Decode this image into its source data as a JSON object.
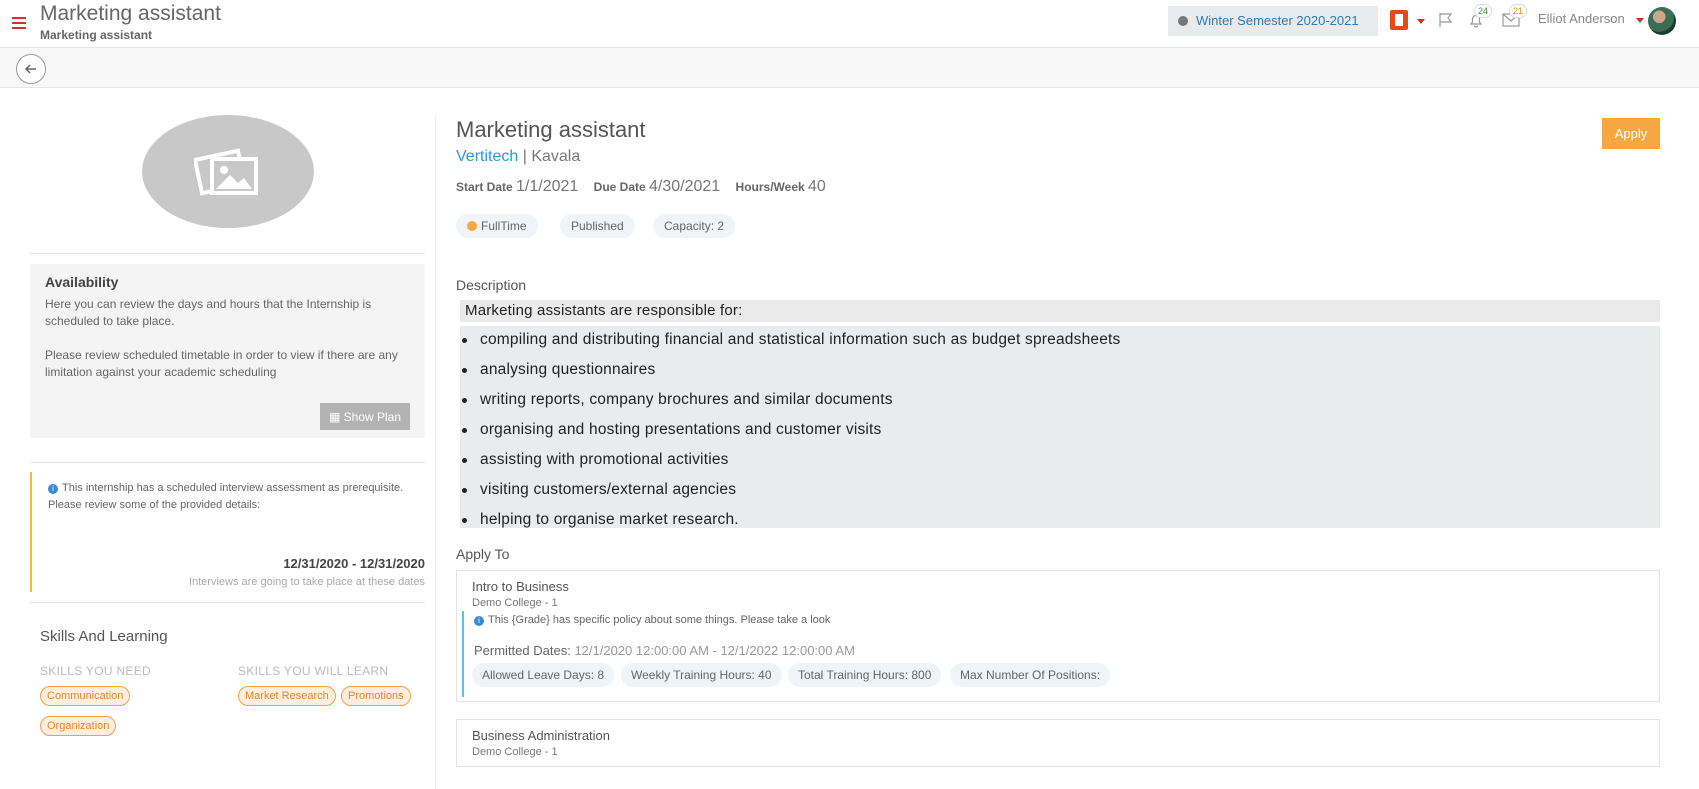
{
  "header": {
    "title": "Marketing assistant",
    "subtitle": "Marketing assistant",
    "semester": "Winter Semester 2020-2021",
    "notifications_count": "24",
    "messages_count": "21",
    "user_name": "Elliot Anderson"
  },
  "left": {
    "availability_title": "Availability",
    "availability_text_1": "Here you can review the days and hours that the Internship is scheduled to take place.",
    "availability_text_2": "Please review scheduled timetable in order to view if there are any limitation against your academic scheduling",
    "show_plan_label": "Show Plan",
    "interview_note_1": "This internship has a scheduled interview assessment as prerequisite.",
    "interview_note_2": "Please review some of the provided details:",
    "interview_dates": "12/31/2020 - 12/31/2020",
    "interview_dates_note": "Interviews are going to take place at these dates",
    "skills_title": "Skills And Learning",
    "skills_need_label": "SKILLS YOU NEED",
    "skills_learn_label": "SKILLS YOU WILL LEARN",
    "skills_need": [
      "Communication",
      "Organization"
    ],
    "skills_learn": [
      "Market Research",
      "Promotions"
    ]
  },
  "job": {
    "title": "Marketing assistant",
    "apply_label": "Apply",
    "company": "Vertitech",
    "separator": "|",
    "location": "Kavala",
    "start_label": "Start Date",
    "start_value": "1/1/2021",
    "due_label": "Due Date",
    "due_value": "4/30/2021",
    "hours_label": "Hours/Week",
    "hours_value": "40",
    "pills": [
      "FullTime",
      "Published",
      "Capacity: 2"
    ]
  },
  "description": {
    "heading": "Description",
    "intro": "Marketing assistants are responsible for:",
    "items": [
      "compiling and distributing financial and statistical information such as budget spreadsheets",
      "analysing questionnaires",
      "writing reports, company brochures and similar documents",
      "organising and hosting presentations and customer visits",
      "assisting with promotional activities",
      "visiting customers/external agencies",
      "helping to organise market research."
    ]
  },
  "apply_to": {
    "heading": "Apply To",
    "programs": [
      {
        "title": "Intro to Business",
        "college": "Demo College - 1",
        "policy_note": "This {Grade} has specific policy about some things. Please take a look",
        "permitted_label": "Permitted Dates:",
        "permitted_dates": "12/1/2020 12:00:00 AM - 12/1/2022 12:00:00 AM",
        "stats": [
          "Allowed Leave Days: 8",
          "Weekly Training Hours: 40",
          "Total Training Hours: 800",
          "Max Number Of Positions:"
        ]
      },
      {
        "title": "Business Administration",
        "college": "Demo College - 1"
      }
    ]
  },
  "colors": {
    "accent_orange": "#f5a742",
    "link_blue": "#2b9ad6",
    "menu_red": "#c0392b"
  }
}
